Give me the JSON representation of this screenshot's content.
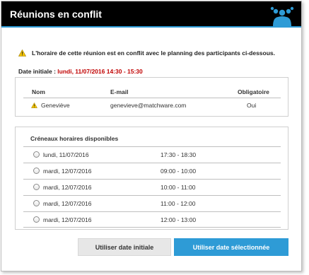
{
  "dialog": {
    "title": "Réunions en conflit",
    "logo_icon": "matchware-people-logo",
    "accent_color": "#2e9bd6"
  },
  "warning": {
    "icon": "warning-triangle-icon",
    "text": "L'horaire de cette réunion est en conflit avec le planning des participants ci-dessous."
  },
  "initial_date": {
    "label": "Date initiale : ",
    "value": "lundi, 11/07/2016 14:30 - 15:30",
    "value_color": "#c00000"
  },
  "participants": {
    "columns": {
      "name": "Nom",
      "email": "E-mail",
      "required": "Obligatoire"
    },
    "rows": [
      {
        "icon": "warning-triangle-icon",
        "name": "Geneviève",
        "email": "genevieve@matchware.com",
        "required": "Oui"
      }
    ]
  },
  "slots": {
    "title": "Créneaux horaires disponibles",
    "items": [
      {
        "day": "lundi, 11/07/2016",
        "time": "17:30 - 18:30"
      },
      {
        "day": "mardi, 12/07/2016",
        "time": "09:00 - 10:00"
      },
      {
        "day": "mardi, 12/07/2016",
        "time": "10:00 - 11:00"
      },
      {
        "day": "mardi, 12/07/2016",
        "time": "11:00 - 12:00"
      },
      {
        "day": "mardi, 12/07/2016",
        "time": "12:00 - 13:00"
      }
    ]
  },
  "buttons": {
    "use_initial": "Utiliser date initiale",
    "use_selected": "Utiliser date sélectionnée"
  }
}
